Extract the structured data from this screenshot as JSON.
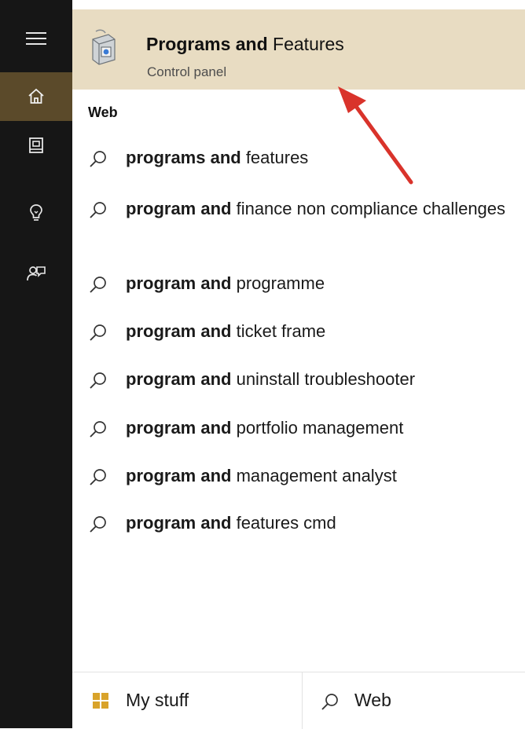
{
  "best_match": {
    "title_bold": "Programs and",
    "title_rest": " Features",
    "subtitle": "Control panel"
  },
  "section_label": "Web",
  "suggestions": [
    {
      "bold": "programs and",
      "rest": " features"
    },
    {
      "bold": "program and",
      "rest": " finance non compliance challenges"
    },
    {
      "bold": "program and",
      "rest": " programme"
    },
    {
      "bold": "program and",
      "rest": " ticket frame"
    },
    {
      "bold": "program and",
      "rest": " uninstall troubleshooter"
    },
    {
      "bold": "program and",
      "rest": " portfolio management"
    },
    {
      "bold": "program and",
      "rest": " management analyst"
    },
    {
      "bold": "program and",
      "rest": " features cmd"
    }
  ],
  "bottom_bar": {
    "my_stuff_label": "My stuff",
    "web_label": "Web"
  },
  "icons": {
    "menu": "hamburger-icon",
    "home": "home-icon",
    "notebook": "notebook-icon",
    "reminders": "lightbulb-icon",
    "feedback": "feedback-icon",
    "program": "control-panel-programs-icon",
    "search": "search-icon",
    "windows": "windows-logo-icon"
  },
  "colors": {
    "rail_bg": "#161616",
    "rail_active": "#5b4a2a",
    "highlight_bg": "#e8dcc2",
    "annotation_arrow": "#d9332b"
  }
}
